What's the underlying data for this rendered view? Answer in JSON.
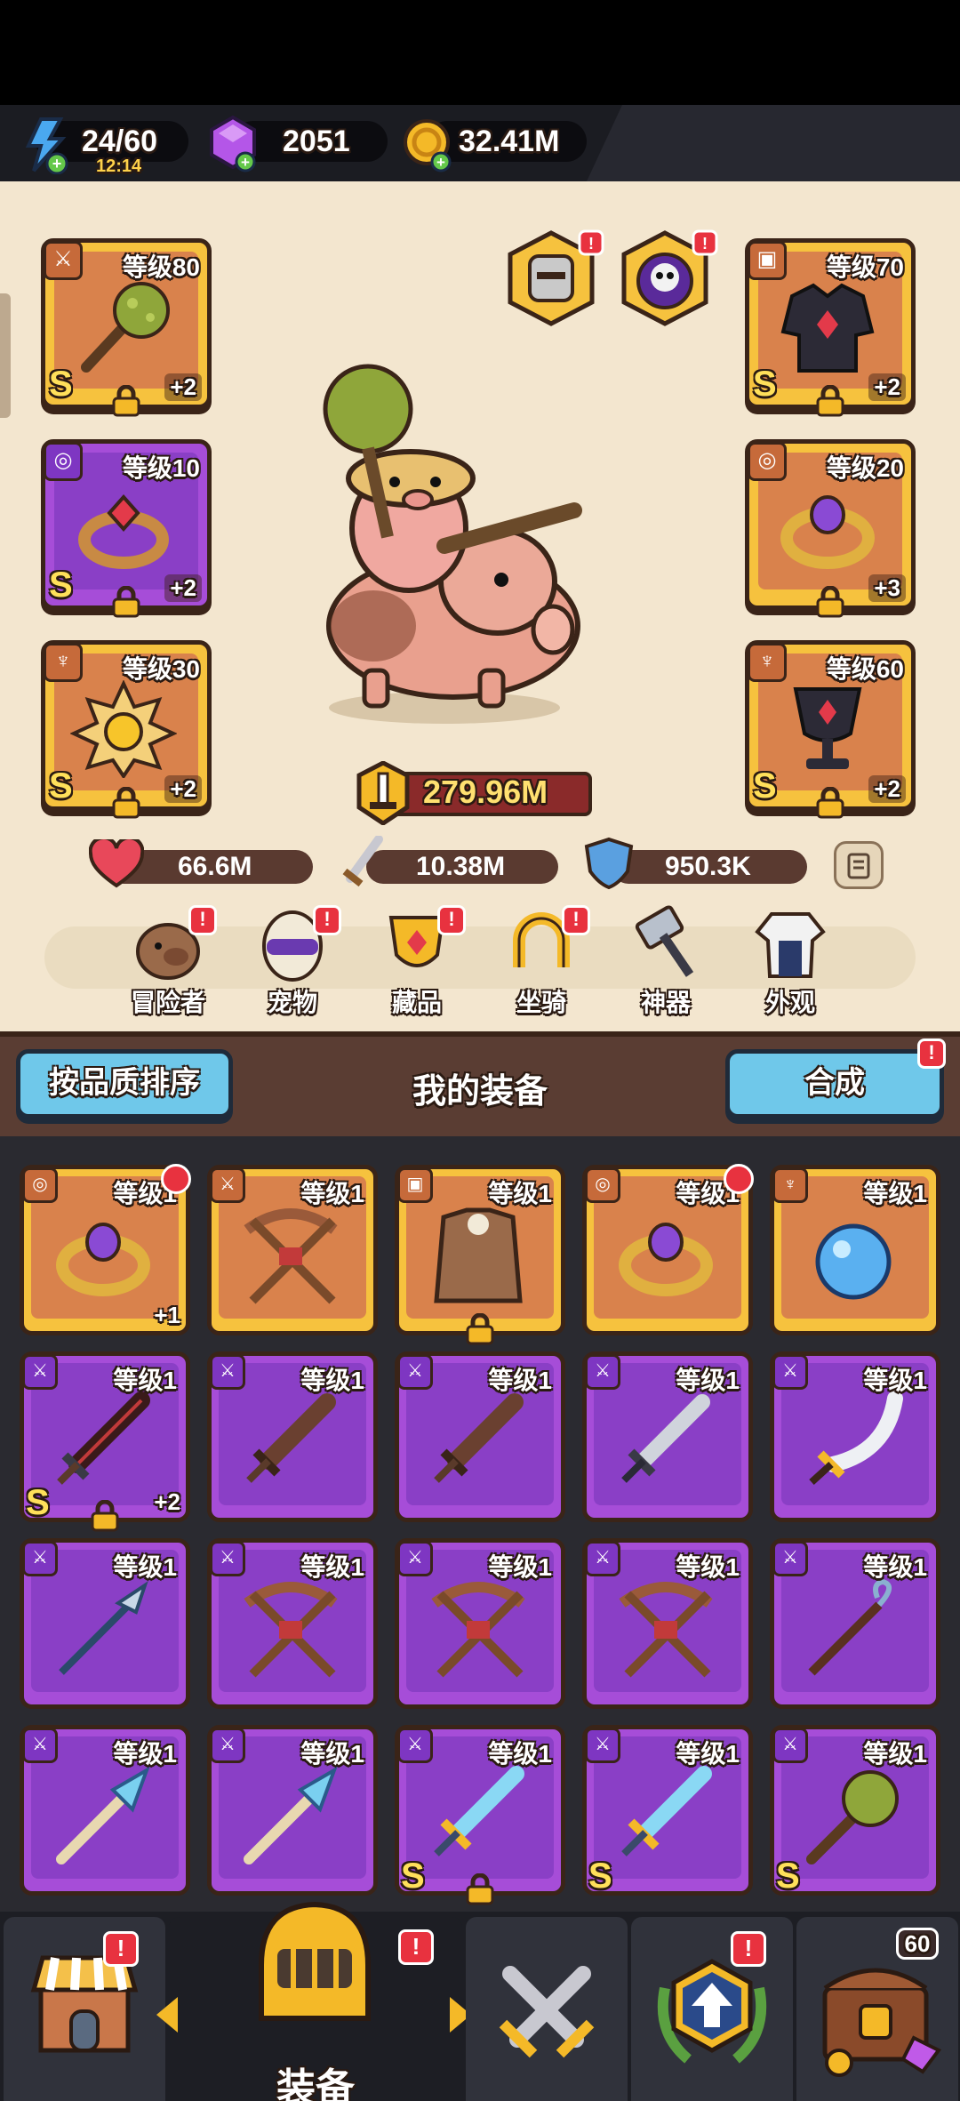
{
  "resources": {
    "energy": {
      "value": "24/60",
      "timer": "12:14",
      "icon": "lightning-icon"
    },
    "gems": {
      "value": "2051",
      "icon": "purple-gem-icon"
    },
    "gold": {
      "value": "32.41M",
      "icon": "gold-coin-icon"
    }
  },
  "character": {
    "power": "279.96M",
    "stats": {
      "hp": "66.6M",
      "attack": "10.38M",
      "defense": "950.3K"
    },
    "left_slots": [
      {
        "type": "weapon",
        "level_label": "等级80",
        "plus": "+2",
        "grade": "S",
        "rarity": "gold",
        "icon": "spiked-club-icon"
      },
      {
        "type": "ring",
        "level_label": "等级10",
        "plus": "+2",
        "grade": "S",
        "rarity": "purple",
        "icon": "ruby-ring-icon"
      },
      {
        "type": "necklace",
        "level_label": "等级30",
        "plus": "+2",
        "grade": "S",
        "rarity": "gold",
        "icon": "sun-amulet-icon"
      }
    ],
    "right_slots": [
      {
        "type": "armor",
        "level_label": "等级70",
        "plus": "+2",
        "grade": "S",
        "rarity": "gold",
        "icon": "dark-armor-icon"
      },
      {
        "type": "ring",
        "level_label": "等级20",
        "plus": "+3",
        "grade": "",
        "rarity": "gold",
        "icon": "amethyst-ring-icon"
      },
      {
        "type": "necklace",
        "level_label": "等级60",
        "plus": "+2",
        "grade": "S",
        "rarity": "gold",
        "icon": "chalice-amulet-icon"
      }
    ]
  },
  "categories": [
    {
      "label": "冒险者",
      "icon": "capybara-icon",
      "badge": "!"
    },
    {
      "label": "宠物",
      "icon": "egg-pet-icon",
      "badge": "!"
    },
    {
      "label": "藏品",
      "icon": "shield-collection-icon",
      "badge": "!"
    },
    {
      "label": "坐骑",
      "icon": "horseshoe-icon",
      "badge": "!"
    },
    {
      "label": "神器",
      "icon": "hammer-icon",
      "badge": ""
    },
    {
      "label": "外观",
      "icon": "outfit-icon",
      "badge": ""
    }
  ],
  "equipment_header": {
    "sort_label": "按品质排序",
    "title": "我的装备",
    "merge_label": "合成",
    "merge_badge": "!"
  },
  "inventory": [
    {
      "level_label": "等级1",
      "rarity": "gold",
      "type": "ring",
      "icon": "amethyst-ring-icon",
      "plus": "+1",
      "grade": "",
      "locked": false,
      "upgrade": true
    },
    {
      "level_label": "等级1",
      "rarity": "gold",
      "type": "weapon",
      "icon": "crossbow-icon",
      "plus": "",
      "grade": "",
      "locked": false,
      "upgrade": false
    },
    {
      "level_label": "等级1",
      "rarity": "gold",
      "type": "armor",
      "icon": "leather-vest-icon",
      "plus": "",
      "grade": "",
      "locked": true,
      "upgrade": false
    },
    {
      "level_label": "等级1",
      "rarity": "gold",
      "type": "ring",
      "icon": "amethyst-ring-icon",
      "plus": "",
      "grade": "",
      "locked": false,
      "upgrade": true
    },
    {
      "level_label": "等级1",
      "rarity": "gold",
      "type": "necklace",
      "icon": "blue-orb-amulet-icon",
      "plus": "",
      "grade": "",
      "locked": false,
      "upgrade": false
    },
    {
      "level_label": "等级1",
      "rarity": "purple",
      "type": "weapon",
      "icon": "dark-greatsword-icon",
      "plus": "+2",
      "grade": "S",
      "locked": true,
      "upgrade": false
    },
    {
      "level_label": "等级1",
      "rarity": "purple",
      "type": "weapon",
      "icon": "wooden-sword-icon",
      "plus": "",
      "grade": "",
      "locked": false,
      "upgrade": false
    },
    {
      "level_label": "等级1",
      "rarity": "purple",
      "type": "weapon",
      "icon": "wooden-sword-icon",
      "plus": "",
      "grade": "",
      "locked": false,
      "upgrade": false
    },
    {
      "level_label": "等级1",
      "rarity": "purple",
      "type": "weapon",
      "icon": "steel-sword-icon",
      "plus": "",
      "grade": "",
      "locked": false,
      "upgrade": false
    },
    {
      "level_label": "等级1",
      "rarity": "purple",
      "type": "weapon",
      "icon": "scimitar-icon",
      "plus": "",
      "grade": "",
      "locked": false,
      "upgrade": false
    },
    {
      "level_label": "等级1",
      "rarity": "purple",
      "type": "weapon",
      "icon": "spear-icon",
      "plus": "",
      "grade": "",
      "locked": false,
      "upgrade": false
    },
    {
      "level_label": "等级1",
      "rarity": "purple",
      "type": "weapon",
      "icon": "crossbow-icon",
      "plus": "",
      "grade": "",
      "locked": false,
      "upgrade": false
    },
    {
      "level_label": "等级1",
      "rarity": "purple",
      "type": "weapon",
      "icon": "crossbow-icon",
      "plus": "",
      "grade": "",
      "locked": false,
      "upgrade": false
    },
    {
      "level_label": "等级1",
      "rarity": "purple",
      "type": "weapon",
      "icon": "crossbow-icon",
      "plus": "",
      "grade": "",
      "locked": false,
      "upgrade": false
    },
    {
      "level_label": "等级1",
      "rarity": "purple",
      "type": "weapon",
      "icon": "magic-staff-icon",
      "plus": "",
      "grade": "",
      "locked": false,
      "upgrade": false
    },
    {
      "level_label": "等级1",
      "rarity": "purple",
      "type": "weapon",
      "icon": "crystal-wand-icon",
      "plus": "",
      "grade": "",
      "locked": false,
      "upgrade": false
    },
    {
      "level_label": "等级1",
      "rarity": "purple",
      "type": "weapon",
      "icon": "crystal-wand-icon",
      "plus": "",
      "grade": "",
      "locked": false,
      "upgrade": false
    },
    {
      "level_label": "等级1",
      "rarity": "purple",
      "type": "weapon",
      "icon": "ice-sword-icon",
      "plus": "",
      "grade": "S",
      "locked": true,
      "upgrade": false
    },
    {
      "level_label": "等级1",
      "rarity": "purple",
      "type": "weapon",
      "icon": "ice-sword-icon",
      "plus": "",
      "grade": "S",
      "locked": false,
      "upgrade": false
    },
    {
      "level_label": "等级1",
      "rarity": "purple",
      "type": "weapon",
      "icon": "spiked-club-icon",
      "plus": "",
      "grade": "S",
      "locked": false,
      "upgrade": false
    }
  ],
  "bottom_nav": {
    "active_label": "装备",
    "tabs": [
      {
        "name": "shop",
        "icon": "shop-icon",
        "badge": "!"
      },
      {
        "name": "equipment",
        "icon": "knight-helmet-icon",
        "badge": "!"
      },
      {
        "name": "battle",
        "icon": "crossed-swords-icon",
        "badge": ""
      },
      {
        "name": "upgrade",
        "icon": "upgrade-emblem-icon",
        "badge": "!"
      },
      {
        "name": "chest",
        "icon": "treasure-chest-icon",
        "badge": "60"
      }
    ]
  }
}
